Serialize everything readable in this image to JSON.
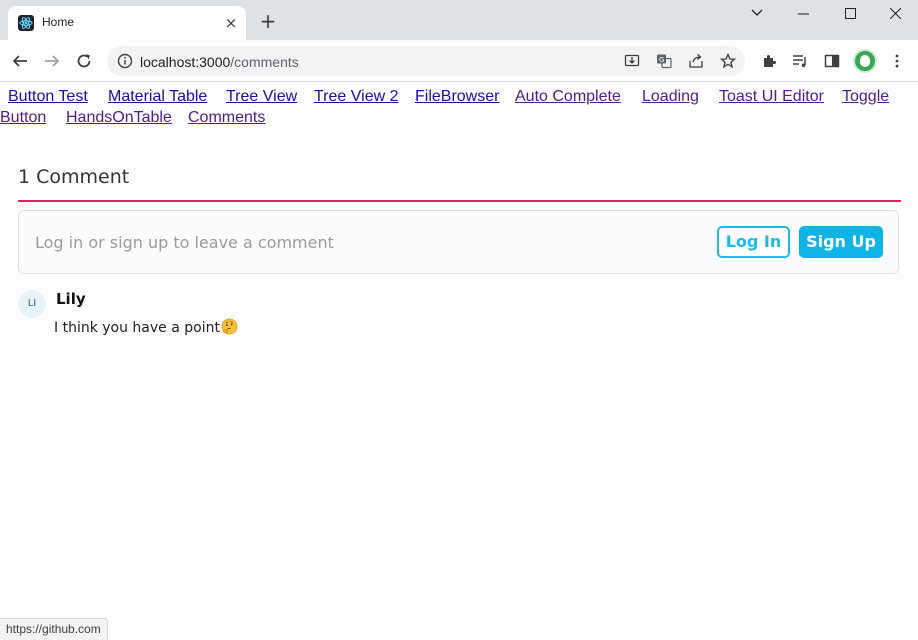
{
  "browser": {
    "tab_title": "Home",
    "tab_close": "×",
    "new_tab": "+",
    "url_host": "localhost:3000",
    "url_path": "/comments",
    "status_url": "https://github.com",
    "icons": [
      "react-favicon-icon",
      "back-icon",
      "forward-icon",
      "reload-icon",
      "info-icon",
      "install-icon",
      "translate-icon",
      "share-icon",
      "star-icon",
      "extensions-icon",
      "media-icon",
      "side-panel-icon",
      "profile-avatar",
      "more-icon",
      "minimize-icon",
      "maximize-icon",
      "close-icon"
    ]
  },
  "nav": {
    "links": [
      {
        "label": "Button Test"
      },
      {
        "label": "Material Table"
      },
      {
        "label": "Tree View"
      },
      {
        "label": "Tree View 2"
      },
      {
        "label": "FileBrowser"
      },
      {
        "label": "Auto Complete"
      },
      {
        "label": "Loading"
      },
      {
        "label": "Toast UI Editor"
      },
      {
        "label": "Toggle"
      },
      {
        "label": "Button"
      },
      {
        "label": "HandsOnTable"
      },
      {
        "label": "Comments"
      }
    ]
  },
  "comments": {
    "heading": "1 Comment",
    "accent_color": "#e0215a",
    "login_prompt": "Log in or sign up to leave a comment",
    "login_label": "Log In",
    "signup_label": "Sign Up",
    "button_color": "#0fb4e4",
    "items": [
      {
        "initials": "LI",
        "author": "Lily",
        "text": "I think you have a point",
        "emoji": "thinking-face"
      }
    ]
  }
}
